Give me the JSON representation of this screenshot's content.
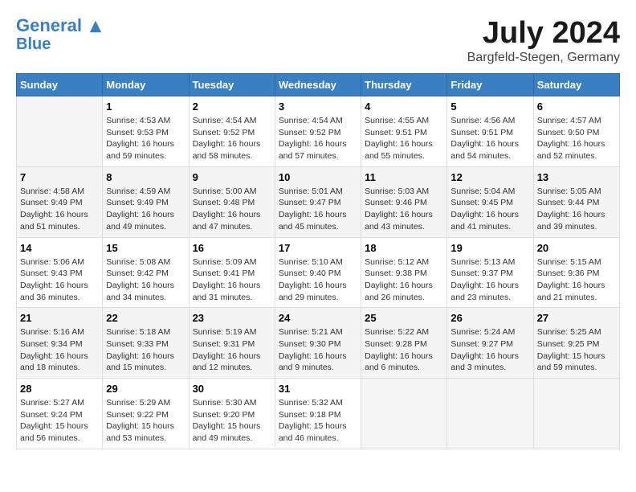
{
  "header": {
    "logo_line1": "General",
    "logo_line2": "Blue",
    "month": "July 2024",
    "location": "Bargfeld-Stegen, Germany"
  },
  "weekdays": [
    "Sunday",
    "Monday",
    "Tuesday",
    "Wednesday",
    "Thursday",
    "Friday",
    "Saturday"
  ],
  "weeks": [
    [
      {
        "day": "",
        "info": ""
      },
      {
        "day": "1",
        "info": "Sunrise: 4:53 AM\nSunset: 9:53 PM\nDaylight: 16 hours\nand 59 minutes."
      },
      {
        "day": "2",
        "info": "Sunrise: 4:54 AM\nSunset: 9:52 PM\nDaylight: 16 hours\nand 58 minutes."
      },
      {
        "day": "3",
        "info": "Sunrise: 4:54 AM\nSunset: 9:52 PM\nDaylight: 16 hours\nand 57 minutes."
      },
      {
        "day": "4",
        "info": "Sunrise: 4:55 AM\nSunset: 9:51 PM\nDaylight: 16 hours\nand 55 minutes."
      },
      {
        "day": "5",
        "info": "Sunrise: 4:56 AM\nSunset: 9:51 PM\nDaylight: 16 hours\nand 54 minutes."
      },
      {
        "day": "6",
        "info": "Sunrise: 4:57 AM\nSunset: 9:50 PM\nDaylight: 16 hours\nand 52 minutes."
      }
    ],
    [
      {
        "day": "7",
        "info": "Sunrise: 4:58 AM\nSunset: 9:49 PM\nDaylight: 16 hours\nand 51 minutes."
      },
      {
        "day": "8",
        "info": "Sunrise: 4:59 AM\nSunset: 9:49 PM\nDaylight: 16 hours\nand 49 minutes."
      },
      {
        "day": "9",
        "info": "Sunrise: 5:00 AM\nSunset: 9:48 PM\nDaylight: 16 hours\nand 47 minutes."
      },
      {
        "day": "10",
        "info": "Sunrise: 5:01 AM\nSunset: 9:47 PM\nDaylight: 16 hours\nand 45 minutes."
      },
      {
        "day": "11",
        "info": "Sunrise: 5:03 AM\nSunset: 9:46 PM\nDaylight: 16 hours\nand 43 minutes."
      },
      {
        "day": "12",
        "info": "Sunrise: 5:04 AM\nSunset: 9:45 PM\nDaylight: 16 hours\nand 41 minutes."
      },
      {
        "day": "13",
        "info": "Sunrise: 5:05 AM\nSunset: 9:44 PM\nDaylight: 16 hours\nand 39 minutes."
      }
    ],
    [
      {
        "day": "14",
        "info": "Sunrise: 5:06 AM\nSunset: 9:43 PM\nDaylight: 16 hours\nand 36 minutes."
      },
      {
        "day": "15",
        "info": "Sunrise: 5:08 AM\nSunset: 9:42 PM\nDaylight: 16 hours\nand 34 minutes."
      },
      {
        "day": "16",
        "info": "Sunrise: 5:09 AM\nSunset: 9:41 PM\nDaylight: 16 hours\nand 31 minutes."
      },
      {
        "day": "17",
        "info": "Sunrise: 5:10 AM\nSunset: 9:40 PM\nDaylight: 16 hours\nand 29 minutes."
      },
      {
        "day": "18",
        "info": "Sunrise: 5:12 AM\nSunset: 9:38 PM\nDaylight: 16 hours\nand 26 minutes."
      },
      {
        "day": "19",
        "info": "Sunrise: 5:13 AM\nSunset: 9:37 PM\nDaylight: 16 hours\nand 23 minutes."
      },
      {
        "day": "20",
        "info": "Sunrise: 5:15 AM\nSunset: 9:36 PM\nDaylight: 16 hours\nand 21 minutes."
      }
    ],
    [
      {
        "day": "21",
        "info": "Sunrise: 5:16 AM\nSunset: 9:34 PM\nDaylight: 16 hours\nand 18 minutes."
      },
      {
        "day": "22",
        "info": "Sunrise: 5:18 AM\nSunset: 9:33 PM\nDaylight: 16 hours\nand 15 minutes."
      },
      {
        "day": "23",
        "info": "Sunrise: 5:19 AM\nSunset: 9:31 PM\nDaylight: 16 hours\nand 12 minutes."
      },
      {
        "day": "24",
        "info": "Sunrise: 5:21 AM\nSunset: 9:30 PM\nDaylight: 16 hours\nand 9 minutes."
      },
      {
        "day": "25",
        "info": "Sunrise: 5:22 AM\nSunset: 9:28 PM\nDaylight: 16 hours\nand 6 minutes."
      },
      {
        "day": "26",
        "info": "Sunrise: 5:24 AM\nSunset: 9:27 PM\nDaylight: 16 hours\nand 3 minutes."
      },
      {
        "day": "27",
        "info": "Sunrise: 5:25 AM\nSunset: 9:25 PM\nDaylight: 15 hours\nand 59 minutes."
      }
    ],
    [
      {
        "day": "28",
        "info": "Sunrise: 5:27 AM\nSunset: 9:24 PM\nDaylight: 15 hours\nand 56 minutes."
      },
      {
        "day": "29",
        "info": "Sunrise: 5:29 AM\nSunset: 9:22 PM\nDaylight: 15 hours\nand 53 minutes."
      },
      {
        "day": "30",
        "info": "Sunrise: 5:30 AM\nSunset: 9:20 PM\nDaylight: 15 hours\nand 49 minutes."
      },
      {
        "day": "31",
        "info": "Sunrise: 5:32 AM\nSunset: 9:18 PM\nDaylight: 15 hours\nand 46 minutes."
      },
      {
        "day": "",
        "info": ""
      },
      {
        "day": "",
        "info": ""
      },
      {
        "day": "",
        "info": ""
      }
    ]
  ]
}
